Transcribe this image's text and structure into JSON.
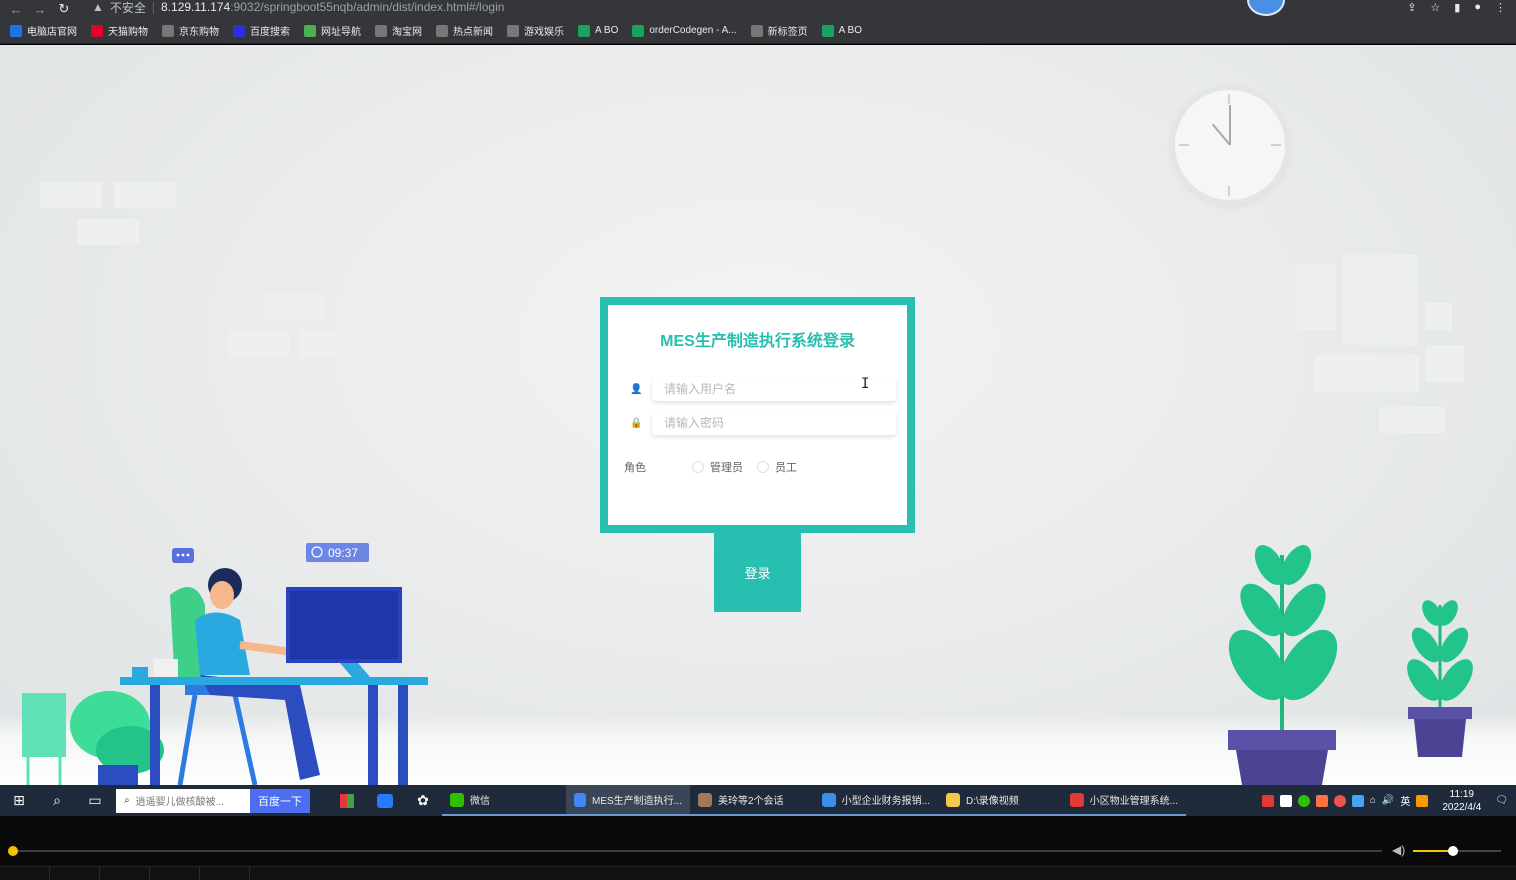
{
  "browser": {
    "not_secure_label": "不安全",
    "url_host": "8.129.11.174",
    "url_path": ":9032/springboot55nqb/admin/dist/index.html#/login",
    "bookmarks": [
      {
        "label": "电脑店官网",
        "color": "#1a73e8"
      },
      {
        "label": "天猫购物",
        "color": "#e4002b"
      },
      {
        "label": "京东购物",
        "color": "#777777"
      },
      {
        "label": "百度搜索",
        "color": "#2932e1"
      },
      {
        "label": "网址导航",
        "color": "#4caf50"
      },
      {
        "label": "淘宝网",
        "color": "#777777"
      },
      {
        "label": "热点新闻",
        "color": "#777777"
      },
      {
        "label": "游戏娱乐",
        "color": "#777777"
      },
      {
        "label": "A BO",
        "color": "#1aa260"
      },
      {
        "label": "orderCodegen - A...",
        "color": "#1aa260"
      },
      {
        "label": "新标签页",
        "color": "#777777"
      },
      {
        "label": "A BO",
        "color": "#1aa260"
      }
    ]
  },
  "login": {
    "title": "MES生产制造执行系统登录",
    "username_placeholder": "请输入用户名",
    "password_placeholder": "请输入密码",
    "role_label": "角色",
    "roles": [
      "管理员",
      "员工"
    ],
    "submit_label": "登录",
    "accent_color": "#28bfb0"
  },
  "illustration": {
    "screen_time": "09:37"
  },
  "taskbar": {
    "search_placeholder": "逍遥婴儿做核酸被...",
    "search_button": "百度一下",
    "apps": [
      {
        "label": "微信",
        "color": "#2dc100",
        "active": false
      },
      {
        "label": "MES生产制造执行...",
        "color": "#4285f4",
        "active": true
      },
      {
        "label": "美玲等2个会话",
        "color": "#a0785a",
        "active": false
      },
      {
        "label": "小型企业财务报销...",
        "color": "#3b8ee8",
        "active": false
      },
      {
        "label": "D:\\录像视频",
        "color": "#f2c94c",
        "active": false
      },
      {
        "label": "小区物业管理系统...",
        "color": "#e53935",
        "active": false
      }
    ],
    "ime_label": "英",
    "time": "11:19",
    "date": "2022/4/4"
  },
  "icons": {
    "user": "user-icon",
    "lock": "lock-icon",
    "start": "windows-start-icon",
    "search": "search-icon",
    "task_view": "task-view-icon",
    "volume": "volume-icon"
  }
}
